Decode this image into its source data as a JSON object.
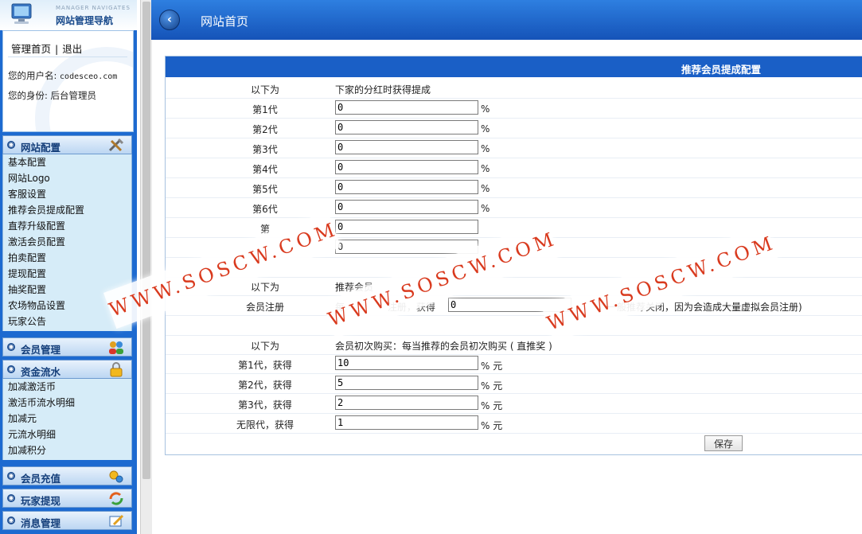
{
  "sidebar": {
    "logo_en": "MANAGER NAVIGATES",
    "logo_cn": "网站管理导航",
    "home_link": "管理首页",
    "link_sep": "|",
    "logout_link": "退出",
    "username_label": "您的用户名:",
    "username": "codesceo.com",
    "role_label": "您的身份:",
    "role": "后台管理员",
    "sections": [
      {
        "label": "网站配置",
        "items": [
          "基本配置",
          "网站Logo",
          "客服设置",
          "推荐会员提成配置",
          "直荐升级配置",
          "激活会员配置",
          "拍卖配置",
          "提现配置",
          "抽奖配置",
          "农场物品设置",
          "玩家公告"
        ]
      },
      {
        "label": "会员管理",
        "items": []
      },
      {
        "label": "资金流水",
        "items": [
          "加减激活币",
          "激活币流水明细",
          "加减元",
          "元流水明细",
          "加减积分"
        ]
      },
      {
        "label": "会员充值",
        "items": []
      },
      {
        "label": "玩家提现",
        "items": []
      },
      {
        "label": "消息管理",
        "items": []
      }
    ]
  },
  "header": {
    "back": "‹",
    "title": "网站首页"
  },
  "form": {
    "title": "推荐会员提成配置",
    "section1": {
      "label": "以下为",
      "desc": "下家的分红时获得提成"
    },
    "gens": [
      {
        "label": "第1代",
        "value": "0",
        "unit": "%"
      },
      {
        "label": "第2代",
        "value": "0",
        "unit": "%"
      },
      {
        "label": "第3代",
        "value": "0",
        "unit": "%"
      },
      {
        "label": "第4代",
        "value": "0",
        "unit": "%"
      },
      {
        "label": "第5代",
        "value": "0",
        "unit": "%"
      },
      {
        "label": "第6代",
        "value": "0",
        "unit": "%"
      },
      {
        "label": "第",
        "value": "0",
        "unit": ""
      },
      {
        "label": "",
        "value": "0",
        "unit": ""
      }
    ],
    "section2": {
      "label": "以下为",
      "desc": "推荐会员"
    },
    "register": {
      "label": "会员注册",
      "pre": "每",
      "mid": "注册，获得",
      "value": "0",
      "post": "一般推荐关闭，因为会造成大量虚拟会员注册)"
    },
    "section3": {
      "label": "以下为",
      "desc": "会员初次购买：每当推荐的会员初次购买 ( 直推奖 )"
    },
    "purchase": [
      {
        "label": "第1代，获得",
        "value": "10",
        "unit": "% 元"
      },
      {
        "label": "第2代，获得",
        "value": "5",
        "unit": "% 元"
      },
      {
        "label": "第3代，获得",
        "value": "2",
        "unit": "% 元"
      },
      {
        "label": "无限代，获得",
        "value": "1",
        "unit": "% 元"
      }
    ],
    "save_label": "保存"
  },
  "watermark": "WWW.SOSCW.COM"
}
